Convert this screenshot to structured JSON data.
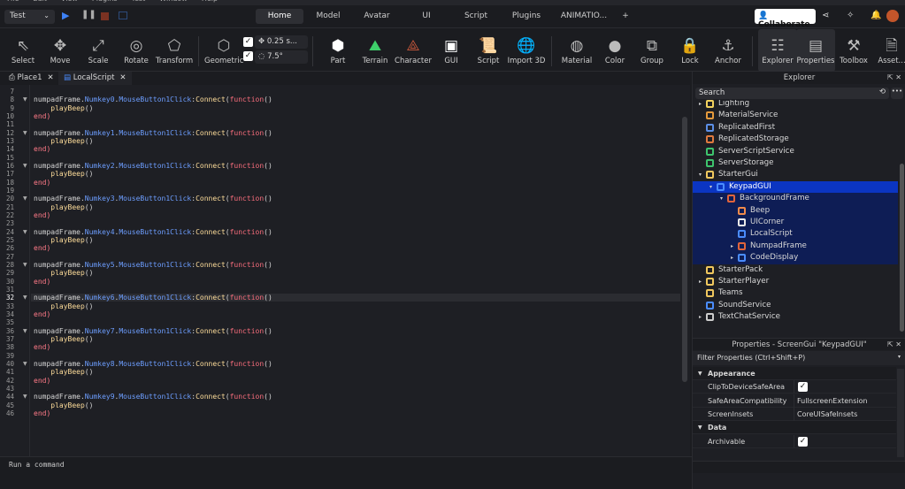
{
  "menu": [
    "File",
    "Edit",
    "View",
    "Plugins",
    "Test",
    "Window",
    "Help"
  ],
  "topbar": {
    "mode": "Test",
    "tabs": [
      "Home",
      "Model",
      "Avatar",
      "UI",
      "Script",
      "Plugins",
      "ANIMATIO...",
      "+"
    ],
    "active_tab": "Home",
    "collaborate": "Collaborate"
  },
  "ribbon": {
    "tools": [
      {
        "label": "Select",
        "icon": "cursor-icon",
        "glyph": "⇖"
      },
      {
        "label": "Move",
        "icon": "move-icon",
        "glyph": "✥"
      },
      {
        "label": "Scale",
        "icon": "scale-icon",
        "glyph": "⤢"
      },
      {
        "label": "Rotate",
        "icon": "rotate-icon",
        "glyph": "◎"
      },
      {
        "label": "Transform",
        "icon": "transform-icon",
        "glyph": "⬠"
      },
      {
        "label": "Geometric",
        "icon": "geometric-icon",
        "glyph": "⬡"
      }
    ],
    "snap_move": "0.25 s...",
    "snap_rotate": "7.5°",
    "snap_move_checked": true,
    "snap_rotate_checked": true,
    "insert": [
      {
        "label": "Part",
        "icon": "part-icon",
        "glyph": "⬢",
        "color": "#ffffff"
      },
      {
        "label": "Terrain",
        "icon": "terrain-icon",
        "glyph": "⛰",
        "color": "#3ecf6a"
      },
      {
        "label": "Character",
        "icon": "character-icon",
        "glyph": "⟁",
        "color": "#c0553a"
      },
      {
        "label": "GUI",
        "icon": "gui-icon",
        "glyph": "▣",
        "color": "#ffffff"
      },
      {
        "label": "Script",
        "icon": "script-icon",
        "glyph": "📜",
        "color": "#b6e36b"
      },
      {
        "label": "Import 3D",
        "icon": "import-3d-icon",
        "glyph": "🌐",
        "color": "#ffffff"
      }
    ],
    "edit": [
      {
        "label": "Material",
        "icon": "material-icon",
        "glyph": "◍"
      },
      {
        "label": "Color",
        "icon": "color-icon",
        "glyph": "●"
      },
      {
        "label": "Group",
        "icon": "group-icon",
        "glyph": "⧉"
      },
      {
        "label": "Lock",
        "icon": "lock-icon",
        "glyph": "🔒"
      },
      {
        "label": "Anchor",
        "icon": "anchor-icon",
        "glyph": "⚓"
      }
    ],
    "panels": [
      {
        "label": "Explorer",
        "icon": "explorer-icon",
        "glyph": "☷",
        "active": true
      },
      {
        "label": "Properties",
        "icon": "properties-icon",
        "glyph": "▤",
        "active": true
      },
      {
        "label": "Toolbox",
        "icon": "toolbox-icon",
        "glyph": "⚒",
        "active": false
      },
      {
        "label": "Asset...",
        "icon": "asset-manager-icon",
        "glyph": "🗎",
        "active": false
      }
    ]
  },
  "doc_tabs": [
    {
      "label": "Place1",
      "active": false
    },
    {
      "label": "LocalScript",
      "active": true
    }
  ],
  "editor": {
    "first_line": 7,
    "current_line": 32,
    "lines": [
      "",
      "numpadFrame.Numkey0.MouseButton1Click:Connect(function()",
      "    playBeep()",
      "end)",
      "",
      "numpadFrame.Numkey1.MouseButton1Click:Connect(function()",
      "    playBeep()",
      "end)",
      "",
      "numpadFrame.Numkey2.MouseButton1Click:Connect(function()",
      "    playBeep()",
      "end)",
      "",
      "numpadFrame.Numkey3.MouseButton1Click:Connect(function()",
      "    playBeep()",
      "end)",
      "",
      "numpadFrame.Numkey4.MouseButton1Click:Connect(function()",
      "    playBeep()",
      "end)",
      "",
      "numpadFrame.Numkey5.MouseButton1Click:Connect(function()",
      "    playBeep()",
      "end)",
      "",
      "numpadFrame.Numkey6.MouseButton1Click:Connect(function()",
      "    playBeep()",
      "end)",
      "",
      "numpadFrame.Numkey7.MouseButton1Click:Connect(function()",
      "    playBeep()",
      "end)",
      "",
      "numpadFrame.Numkey8.MouseButton1Click:Connect(function()",
      "    playBeep()",
      "end)",
      "",
      "numpadFrame.Numkey9.MouseButton1Click:Connect(function()",
      "    playBeep()",
      "end)"
    ]
  },
  "command_bar": {
    "placeholder": "Run a command"
  },
  "explorer": {
    "title": "Explorer",
    "search_placeholder": "Search",
    "items": [
      {
        "label": "Lighting",
        "depth": 0,
        "arrow": "▸",
        "color": "#f4d35e"
      },
      {
        "label": "MaterialService",
        "depth": 0,
        "arrow": "",
        "color": "#e59a3c"
      },
      {
        "label": "ReplicatedFirst",
        "depth": 0,
        "arrow": "",
        "color": "#5c8fe6"
      },
      {
        "label": "ReplicatedStorage",
        "depth": 0,
        "arrow": "",
        "color": "#e07a3f"
      },
      {
        "label": "ServerScriptService",
        "depth": 0,
        "arrow": "",
        "color": "#3ec46d"
      },
      {
        "label": "ServerStorage",
        "depth": 0,
        "arrow": "",
        "color": "#3ec46d"
      },
      {
        "label": "StarterGui",
        "depth": 0,
        "arrow": "▾",
        "color": "#f0c75e"
      },
      {
        "label": "KeypadGUI",
        "depth": 1,
        "arrow": "▾",
        "color": "#4a8cff",
        "sel": 1
      },
      {
        "label": "BackgroundFrame",
        "depth": 2,
        "arrow": "▾",
        "color": "#e0643c",
        "sel": 2
      },
      {
        "label": "Beep",
        "depth": 3,
        "arrow": "",
        "color": "#f08a4b",
        "sel": 2
      },
      {
        "label": "UICorner",
        "depth": 3,
        "arrow": "",
        "color": "#e8e8e8",
        "sel": 2
      },
      {
        "label": "LocalScript",
        "depth": 3,
        "arrow": "",
        "color": "#4a8cff",
        "sel": 2
      },
      {
        "label": "NumpadFrame",
        "depth": 3,
        "arrow": "▸",
        "color": "#e0643c",
        "sel": 2
      },
      {
        "label": "CodeDisplay",
        "depth": 3,
        "arrow": "▸",
        "color": "#4a8cff",
        "sel": 2
      },
      {
        "label": "StarterPack",
        "depth": 0,
        "arrow": "",
        "color": "#f0c75e"
      },
      {
        "label": "StarterPlayer",
        "depth": 0,
        "arrow": "▸",
        "color": "#f0c75e"
      },
      {
        "label": "Teams",
        "depth": 0,
        "arrow": "",
        "color": "#f0c75e"
      },
      {
        "label": "SoundService",
        "depth": 0,
        "arrow": "",
        "color": "#4a8cff"
      },
      {
        "label": "TextChatService",
        "depth": 0,
        "arrow": "▸",
        "color": "#cccccc"
      }
    ]
  },
  "properties": {
    "title": "Properties - ScreenGui \"KeypadGUI\"",
    "filter": "Filter Properties (Ctrl+Shift+P)",
    "rows": [
      {
        "type": "cat",
        "label": "Appearance"
      },
      {
        "type": "check",
        "label": "ClipToDeviceSafeArea",
        "checked": true
      },
      {
        "type": "text",
        "label": "SafeAreaCompatibility",
        "value": "FullscreenExtension"
      },
      {
        "type": "text",
        "label": "ScreenInsets",
        "value": "CoreUISafeInsets"
      },
      {
        "type": "cat",
        "label": "Data"
      },
      {
        "type": "check",
        "label": "Archivable",
        "checked": true
      }
    ]
  },
  "colors": {
    "accent": "#0b35c2",
    "keyword": "#f86d7c",
    "property": "#6d9eff",
    "function": "#fddc9a"
  }
}
